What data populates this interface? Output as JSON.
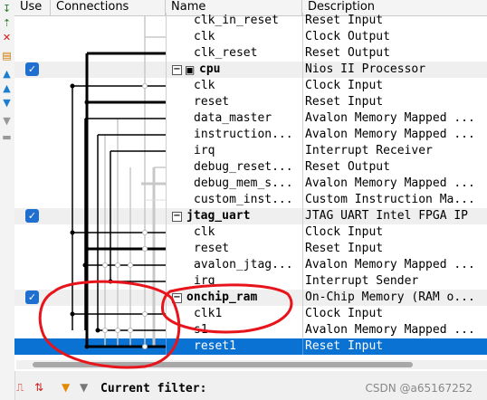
{
  "headers": {
    "use": "Use",
    "connections": "Connections",
    "name": "Name",
    "description": "Description"
  },
  "rows": [
    {
      "kind": "port",
      "name": "clk_in_reset",
      "desc": "Reset Input"
    },
    {
      "kind": "port",
      "name": "clk",
      "desc": "Clock Output"
    },
    {
      "kind": "port",
      "name": "clk_reset",
      "desc": "Reset Output"
    },
    {
      "kind": "group",
      "name": "cpu",
      "desc": "Nios II Processor",
      "checked": true,
      "expander": "⊟",
      "icon": "processor-icon"
    },
    {
      "kind": "port",
      "name": "clk",
      "desc": "Clock Input"
    },
    {
      "kind": "port",
      "name": "reset",
      "desc": "Reset Input"
    },
    {
      "kind": "port",
      "name": "data_master",
      "desc": "Avalon Memory Mapped ..."
    },
    {
      "kind": "port",
      "name": "instruction...",
      "desc": "Avalon Memory Mapped ..."
    },
    {
      "kind": "port",
      "name": "irq",
      "desc": "Interrupt Receiver"
    },
    {
      "kind": "port",
      "name": "debug_reset...",
      "desc": "Reset Output"
    },
    {
      "kind": "port",
      "name": "debug_mem_s...",
      "desc": "Avalon Memory Mapped ..."
    },
    {
      "kind": "port",
      "name": "custom_inst...",
      "desc": "Custom Instruction Ma..."
    },
    {
      "kind": "group",
      "name": "jtag_uart",
      "desc": "JTAG UART Intel FPGA IP",
      "checked": true,
      "expander": "⊟"
    },
    {
      "kind": "port",
      "name": "clk",
      "desc": "Clock Input"
    },
    {
      "kind": "port",
      "name": "reset",
      "desc": "Reset Input"
    },
    {
      "kind": "port",
      "name": "avalon_jtag...",
      "desc": "Avalon Memory Mapped ..."
    },
    {
      "kind": "port",
      "name": "irq",
      "desc": "Interrupt Sender"
    },
    {
      "kind": "group",
      "name": "onchip_ram",
      "desc": "On-Chip Memory (RAM o...",
      "checked": true,
      "expander": "⊟"
    },
    {
      "kind": "port",
      "name": "clk1",
      "desc": "Clock Input"
    },
    {
      "kind": "port",
      "name": "s1",
      "desc": "Avalon Memory Mapped ..."
    },
    {
      "kind": "port",
      "name": "reset1",
      "desc": "Reset Input",
      "selected": true
    }
  ],
  "bottom": {
    "filter_label": "Current filter:",
    "watermark": "CSDN @a65167252"
  },
  "colors": {
    "selection": "#0a72d3",
    "checkbox": "#1e6fcf",
    "annotation": "#e8141c"
  }
}
